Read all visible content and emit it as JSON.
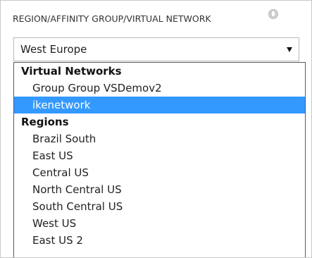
{
  "field": {
    "label": "REGION/AFFINITY GROUP/VIRTUAL NETWORK",
    "help_icon": "help-icon"
  },
  "select": {
    "value": "West Europe",
    "arrow_icon": "dropdown-arrow-icon"
  },
  "dropdown": {
    "groups": [
      {
        "label": "Virtual Networks",
        "options": [
          {
            "label": "Group Group VSDemov2",
            "selected": false
          },
          {
            "label": "ikenetwork",
            "selected": true
          }
        ]
      },
      {
        "label": "Regions",
        "options": [
          {
            "label": "Brazil South",
            "selected": false
          },
          {
            "label": "East US",
            "selected": false
          },
          {
            "label": "Central US",
            "selected": false
          },
          {
            "label": "North Central US",
            "selected": false
          },
          {
            "label": "South Central US",
            "selected": false
          },
          {
            "label": "West US",
            "selected": false
          },
          {
            "label": "East US 2",
            "selected": false
          }
        ]
      }
    ]
  },
  "colors": {
    "highlight": "#3399ff",
    "border": "#b9b9b9"
  }
}
